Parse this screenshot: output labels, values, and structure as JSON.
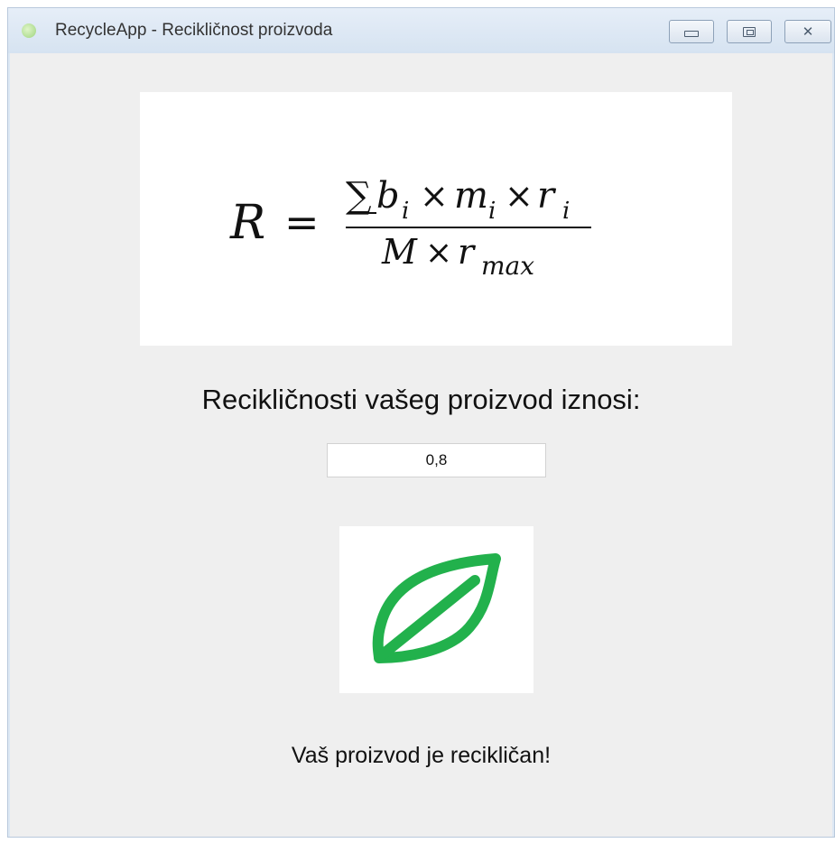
{
  "window": {
    "title": "RecycleApp - Recikličnost proizvoda",
    "app_icon": "app-leaf-icon",
    "controls": {
      "minimize_icon": "minimize-icon",
      "maximize_icon": "maximize-icon",
      "close_icon": "close-icon",
      "close_glyph": "✕"
    }
  },
  "formula": {
    "lhs": "R",
    "equals": "=",
    "sum": "∑",
    "b": "b",
    "m": "m",
    "r": "r",
    "sub_i": "i",
    "times": "×",
    "M": "M",
    "sub_max": "max"
  },
  "result": {
    "label": "Recikličnosti vašeg proizvod iznosi:",
    "value": "0,8"
  },
  "leaf": {
    "icon": "leaf-icon",
    "color": "#22b14c"
  },
  "status": {
    "message": "Vaš proizvod je recikličan!"
  }
}
